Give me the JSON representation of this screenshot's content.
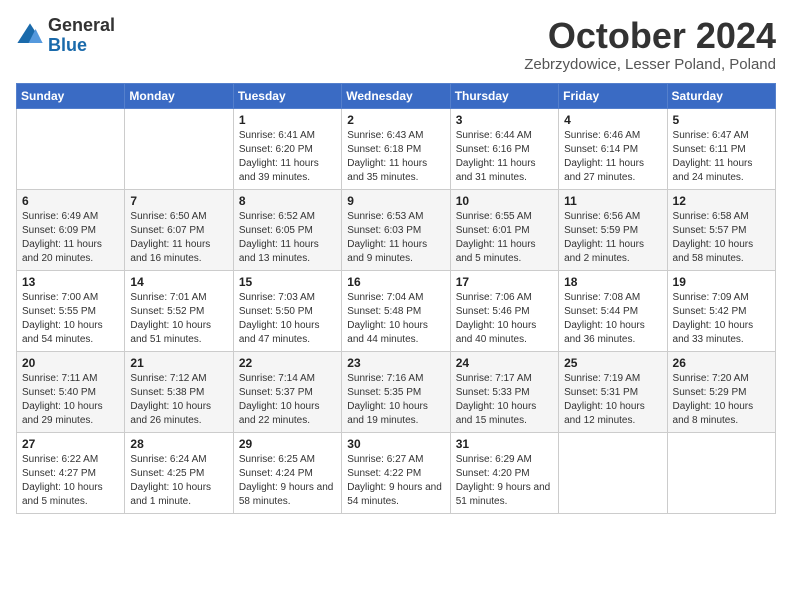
{
  "logo": {
    "general": "General",
    "blue": "Blue"
  },
  "header": {
    "month": "October 2024",
    "location": "Zebrzydowice, Lesser Poland, Poland"
  },
  "weekdays": [
    "Sunday",
    "Monday",
    "Tuesday",
    "Wednesday",
    "Thursday",
    "Friday",
    "Saturday"
  ],
  "weeks": [
    [
      {
        "day": "",
        "content": ""
      },
      {
        "day": "",
        "content": ""
      },
      {
        "day": "1",
        "content": "Sunrise: 6:41 AM\nSunset: 6:20 PM\nDaylight: 11 hours and 39 minutes."
      },
      {
        "day": "2",
        "content": "Sunrise: 6:43 AM\nSunset: 6:18 PM\nDaylight: 11 hours and 35 minutes."
      },
      {
        "day": "3",
        "content": "Sunrise: 6:44 AM\nSunset: 6:16 PM\nDaylight: 11 hours and 31 minutes."
      },
      {
        "day": "4",
        "content": "Sunrise: 6:46 AM\nSunset: 6:14 PM\nDaylight: 11 hours and 27 minutes."
      },
      {
        "day": "5",
        "content": "Sunrise: 6:47 AM\nSunset: 6:11 PM\nDaylight: 11 hours and 24 minutes."
      }
    ],
    [
      {
        "day": "6",
        "content": "Sunrise: 6:49 AM\nSunset: 6:09 PM\nDaylight: 11 hours and 20 minutes."
      },
      {
        "day": "7",
        "content": "Sunrise: 6:50 AM\nSunset: 6:07 PM\nDaylight: 11 hours and 16 minutes."
      },
      {
        "day": "8",
        "content": "Sunrise: 6:52 AM\nSunset: 6:05 PM\nDaylight: 11 hours and 13 minutes."
      },
      {
        "day": "9",
        "content": "Sunrise: 6:53 AM\nSunset: 6:03 PM\nDaylight: 11 hours and 9 minutes."
      },
      {
        "day": "10",
        "content": "Sunrise: 6:55 AM\nSunset: 6:01 PM\nDaylight: 11 hours and 5 minutes."
      },
      {
        "day": "11",
        "content": "Sunrise: 6:56 AM\nSunset: 5:59 PM\nDaylight: 11 hours and 2 minutes."
      },
      {
        "day": "12",
        "content": "Sunrise: 6:58 AM\nSunset: 5:57 PM\nDaylight: 10 hours and 58 minutes."
      }
    ],
    [
      {
        "day": "13",
        "content": "Sunrise: 7:00 AM\nSunset: 5:55 PM\nDaylight: 10 hours and 54 minutes."
      },
      {
        "day": "14",
        "content": "Sunrise: 7:01 AM\nSunset: 5:52 PM\nDaylight: 10 hours and 51 minutes."
      },
      {
        "day": "15",
        "content": "Sunrise: 7:03 AM\nSunset: 5:50 PM\nDaylight: 10 hours and 47 minutes."
      },
      {
        "day": "16",
        "content": "Sunrise: 7:04 AM\nSunset: 5:48 PM\nDaylight: 10 hours and 44 minutes."
      },
      {
        "day": "17",
        "content": "Sunrise: 7:06 AM\nSunset: 5:46 PM\nDaylight: 10 hours and 40 minutes."
      },
      {
        "day": "18",
        "content": "Sunrise: 7:08 AM\nSunset: 5:44 PM\nDaylight: 10 hours and 36 minutes."
      },
      {
        "day": "19",
        "content": "Sunrise: 7:09 AM\nSunset: 5:42 PM\nDaylight: 10 hours and 33 minutes."
      }
    ],
    [
      {
        "day": "20",
        "content": "Sunrise: 7:11 AM\nSunset: 5:40 PM\nDaylight: 10 hours and 29 minutes."
      },
      {
        "day": "21",
        "content": "Sunrise: 7:12 AM\nSunset: 5:38 PM\nDaylight: 10 hours and 26 minutes."
      },
      {
        "day": "22",
        "content": "Sunrise: 7:14 AM\nSunset: 5:37 PM\nDaylight: 10 hours and 22 minutes."
      },
      {
        "day": "23",
        "content": "Sunrise: 7:16 AM\nSunset: 5:35 PM\nDaylight: 10 hours and 19 minutes."
      },
      {
        "day": "24",
        "content": "Sunrise: 7:17 AM\nSunset: 5:33 PM\nDaylight: 10 hours and 15 minutes."
      },
      {
        "day": "25",
        "content": "Sunrise: 7:19 AM\nSunset: 5:31 PM\nDaylight: 10 hours and 12 minutes."
      },
      {
        "day": "26",
        "content": "Sunrise: 7:20 AM\nSunset: 5:29 PM\nDaylight: 10 hours and 8 minutes."
      }
    ],
    [
      {
        "day": "27",
        "content": "Sunrise: 6:22 AM\nSunset: 4:27 PM\nDaylight: 10 hours and 5 minutes."
      },
      {
        "day": "28",
        "content": "Sunrise: 6:24 AM\nSunset: 4:25 PM\nDaylight: 10 hours and 1 minute."
      },
      {
        "day": "29",
        "content": "Sunrise: 6:25 AM\nSunset: 4:24 PM\nDaylight: 9 hours and 58 minutes."
      },
      {
        "day": "30",
        "content": "Sunrise: 6:27 AM\nSunset: 4:22 PM\nDaylight: 9 hours and 54 minutes."
      },
      {
        "day": "31",
        "content": "Sunrise: 6:29 AM\nSunset: 4:20 PM\nDaylight: 9 hours and 51 minutes."
      },
      {
        "day": "",
        "content": ""
      },
      {
        "day": "",
        "content": ""
      }
    ]
  ]
}
